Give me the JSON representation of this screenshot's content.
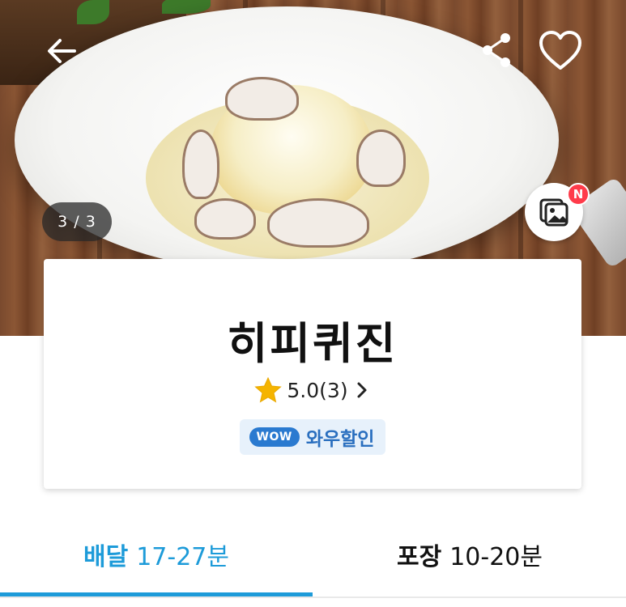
{
  "header": {
    "back_icon": "arrow-left-icon",
    "share_icon": "share-icon",
    "favorite_icon": "heart-outline-icon"
  },
  "gallery": {
    "counter": "3 / 3",
    "photo_reviews_icon": "photo-gallery-icon",
    "new_badge": "N"
  },
  "store": {
    "name": "히피퀴진",
    "rating": "5.0(3)",
    "rating_icon": "star-icon",
    "rating_arrow_icon": "chevron-right-icon",
    "wow_pill": "WOW",
    "wow_label": "와우할인"
  },
  "tabs": [
    {
      "label": "배달",
      "time": "17-27분",
      "active": true
    },
    {
      "label": "포장",
      "time": "10-20분",
      "active": false
    }
  ],
  "colors": {
    "accent": "#1d9bd9",
    "wow_blue": "#2a7ad0",
    "star": "#f5b400",
    "badge_red": "#ff3b4a"
  }
}
